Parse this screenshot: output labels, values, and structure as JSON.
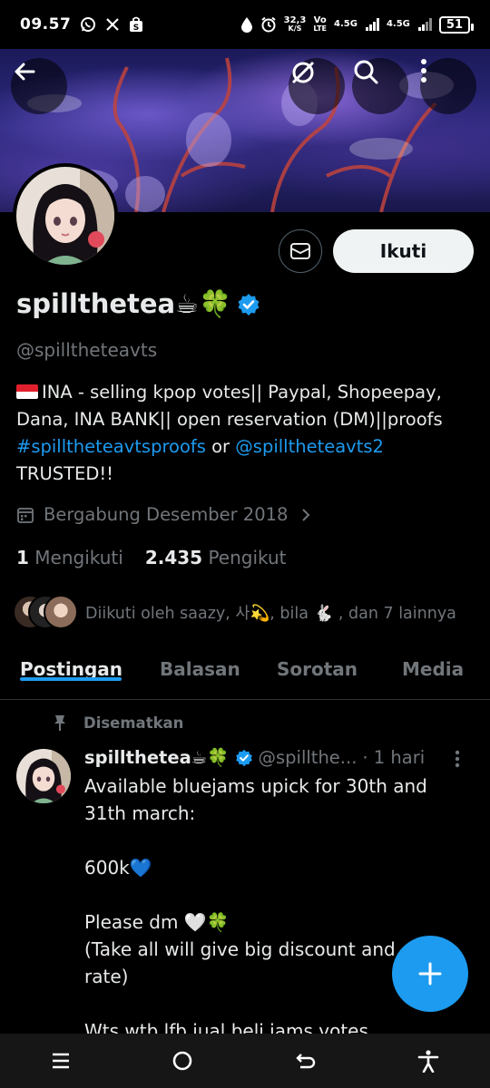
{
  "status_bar": {
    "time": "09.57",
    "net_speed": "32,3",
    "net_speed_unit": "K/S",
    "volte_top": "Vo",
    "volte_bottom": "LTE",
    "signal1": "4.5G",
    "signal2": "4.5G",
    "battery": "51"
  },
  "profile": {
    "display_name": "spillthetea☕🍀",
    "handle": "@spilltheteavts",
    "bio_line1": "INA - selling kpop votes|| Paypal, Shopeepay,",
    "bio_line2": "Dana, INA BANK|| open reservation (DM)||proofs",
    "bio_hashtag": "#spilltheteavtsproofs",
    "bio_or": " or ",
    "bio_mention": "@spilltheteavts2",
    "bio_line4": "TRUSTED!!",
    "joined": "Bergabung Desember 2018",
    "following_count": "1",
    "following_label": "Mengikuti",
    "followers_count": "2.435",
    "followers_label": "Pengikut",
    "followed_by": "Diikuti oleh saazy, 사💫, bila 🐇 , dan 7 lainnya"
  },
  "actions": {
    "follow_label": "Ikuti"
  },
  "tabs": [
    {
      "label": "Postingan",
      "active": true
    },
    {
      "label": "Balasan",
      "active": false
    },
    {
      "label": "Sorotan",
      "active": false
    },
    {
      "label": "Media",
      "active": false
    }
  ],
  "pinned_post": {
    "pinned_label": "Disematkan",
    "name": "spillthetea☕🍀",
    "handle": "@spillthe...",
    "time": "· 1 hari",
    "body": "Available bluejams upick for 30th and\n31th march:\n\n600k💙\n\nPlease dm 🤍🍀\n(Take all will give big discount and\nrate)\n\nWts wtb lfb jual beli jams votes"
  },
  "colors": {
    "accent": "#1d9bf0",
    "background": "#000000",
    "secondary_text": "#71767b"
  },
  "icons": [
    "back-arrow-icon",
    "grok-icon",
    "search-icon",
    "more-vertical-icon",
    "mail-icon",
    "verified-badge-icon",
    "calendar-icon",
    "chevron-right-icon",
    "pin-icon",
    "plus-icon"
  ]
}
